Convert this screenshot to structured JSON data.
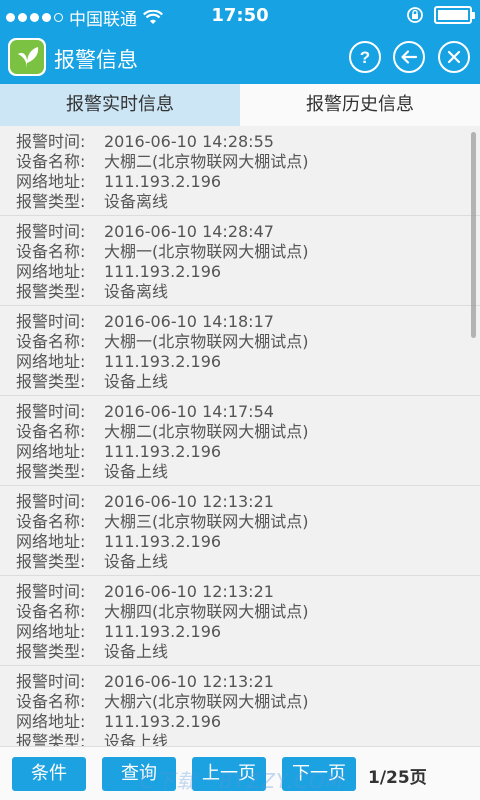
{
  "status_bar": {
    "carrier": "中国联通",
    "time": "17:50",
    "signal_dots_filled": 4,
    "signal_dots_total": 5,
    "battery_level": 1.0
  },
  "header": {
    "title": "报警信息",
    "icons": [
      "app-logo-icon",
      "help-icon",
      "back-arrow-icon",
      "close-icon"
    ]
  },
  "tabs": [
    {
      "label": "报警实时信息",
      "active": true
    },
    {
      "label": "报警历史信息",
      "active": false
    }
  ],
  "labels": {
    "time": "报警时间:",
    "device": "设备名称:",
    "address": "网络地址:",
    "type": "报警类型:"
  },
  "alarms": [
    {
      "time": "2016-06-10 14:28:55",
      "device": "大棚二(北京物联网大棚试点)",
      "address": "111.193.2.196",
      "type": "设备离线"
    },
    {
      "time": "2016-06-10 14:28:47",
      "device": "大棚一(北京物联网大棚试点)",
      "address": "111.193.2.196",
      "type": "设备离线"
    },
    {
      "time": "2016-06-10 14:18:17",
      "device": "大棚一(北京物联网大棚试点)",
      "address": "111.193.2.196",
      "type": "设备上线"
    },
    {
      "time": "2016-06-10 14:17:54",
      "device": "大棚二(北京物联网大棚试点)",
      "address": "111.193.2.196",
      "type": "设备上线"
    },
    {
      "time": "2016-06-10 12:13:21",
      "device": "大棚三(北京物联网大棚试点)",
      "address": "111.193.2.196",
      "type": "设备上线"
    },
    {
      "time": "2016-06-10 12:13:21",
      "device": "大棚四(北京物联网大棚试点)",
      "address": "111.193.2.196",
      "type": "设备上线"
    },
    {
      "time": "2016-06-10 12:13:21",
      "device": "大棚六(北京物联网大棚试点)",
      "address": "111.193.2.196",
      "type": "设备上线"
    }
  ],
  "bottom_bar": {
    "condition_label": "条件",
    "query_label": "查询",
    "prev_label": "上一页",
    "next_label": "下一页",
    "page_info": "1/25页"
  },
  "watermark": "C下载 · BYZZY.COM",
  "colors": {
    "primary": "#17a3e3",
    "button": "#1ca2e0",
    "tab_active": "#cce6f5",
    "logo_green": "#7cc242"
  }
}
